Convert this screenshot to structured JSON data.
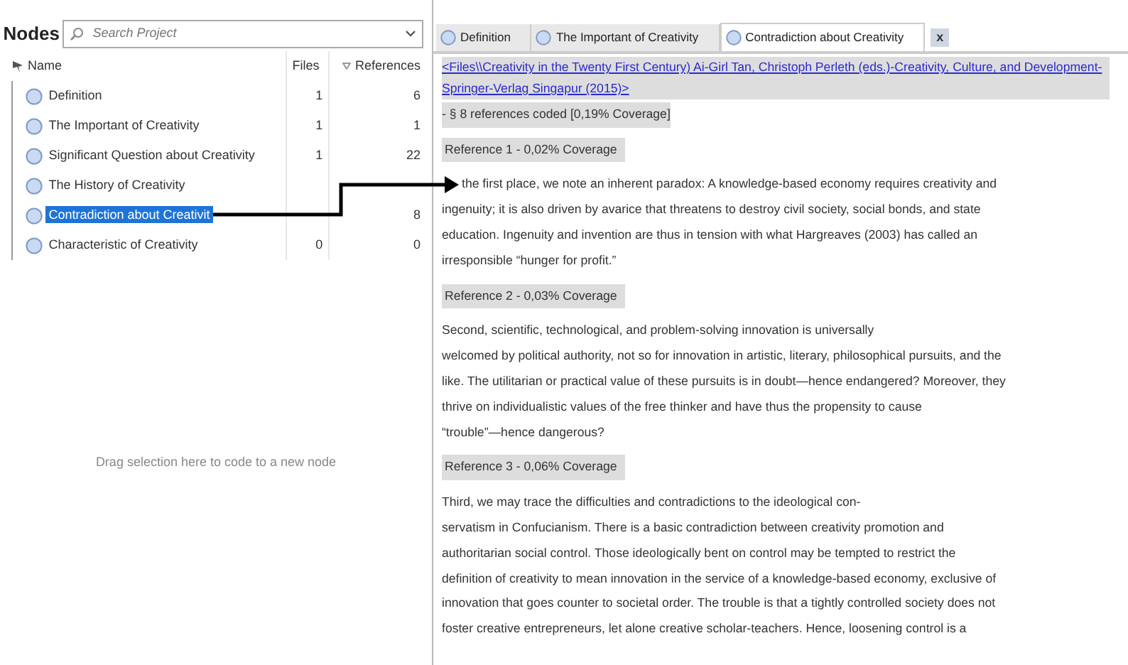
{
  "nodes_panel": {
    "title": "Nodes",
    "search": {
      "placeholder": "Search Project"
    },
    "columns": [
      "Name",
      "Files",
      "References"
    ],
    "rows": [
      {
        "name": "Definition",
        "files": "1",
        "references": "6",
        "selected": false
      },
      {
        "name": "The Important of Creativity",
        "files": "1",
        "references": "1",
        "selected": false
      },
      {
        "name": "Significant Question about Creativity",
        "files": "1",
        "references": "22",
        "selected": false
      },
      {
        "name": "The History of Creativity",
        "selected": false
      },
      {
        "name": "Contradiction about Creativit",
        "references": "8",
        "selected": true
      },
      {
        "name": "Characteristic of Creativity",
        "files": "0",
        "references": "0",
        "selected": false
      }
    ],
    "drop_hint": "Drag selection here to code to a new node"
  },
  "detail_tabs": [
    {
      "label": "Definition",
      "selected": false
    },
    {
      "label": "The Important of Creativity",
      "selected": false
    },
    {
      "label": "Contradiction about Creativity",
      "selected": true
    }
  ],
  "tab_close": "x",
  "source": {
    "link": "<Files\\\\Creativity in the Twenty First Century) Ai-Girl Tan, Christoph Perleth (eds.)-Creativity, Culture, and Development-Springer-Verlag Singapur (2015)>",
    "summary": " - § 8 references coded  [0,19% Coverage]"
  },
  "references": [
    {
      "heading": "Reference 1 - 0,02% Coverage",
      "lines": [
        "the first place, we note an inherent paradox: A knowledge-based economy requires creativity and",
        "ingenuity; it is also driven by avarice that threatens to destroy civil society, social bonds, and state",
        "education. Ingenuity and invention are thus in tension with what Hargreaves (2003) has called an",
        "irresponsible “hunger for profit.”"
      ]
    },
    {
      "heading": "Reference 2 - 0,03% Coverage",
      "lines": [
        "Second, scientific, technological, and problem-solving innovation is universally",
        "welcomed by political authority, not so for innovation in artistic, literary, philosophical pursuits, and the",
        "like. The utilitarian or practical value of these pursuits is in doubt—hence endangered? Moreover, they",
        "thrive on individualistic values of the free thinker and have thus the propensity to cause",
        "“trouble”—hence dangerous?"
      ]
    },
    {
      "heading": "Reference 3 - 0,06% Coverage",
      "lines": [
        "Third, we may trace the difficulties and contradictions to the ideological con-",
        "servatism in Confucianism. There is a basic contradiction between creativity promotion and",
        "authoritarian social control. Those ideologically bent on control may be tempted to restrict the",
        "definition of creativity to mean innovation in the service of a knowledge-based economy, exclusive of",
        "innovation that goes counter to societal order. The trouble is that a tightly controlled society does not",
        "foster creative entrepreneurs, let alone creative scholar-teachers. Hence, loosening control is a"
      ]
    }
  ]
}
